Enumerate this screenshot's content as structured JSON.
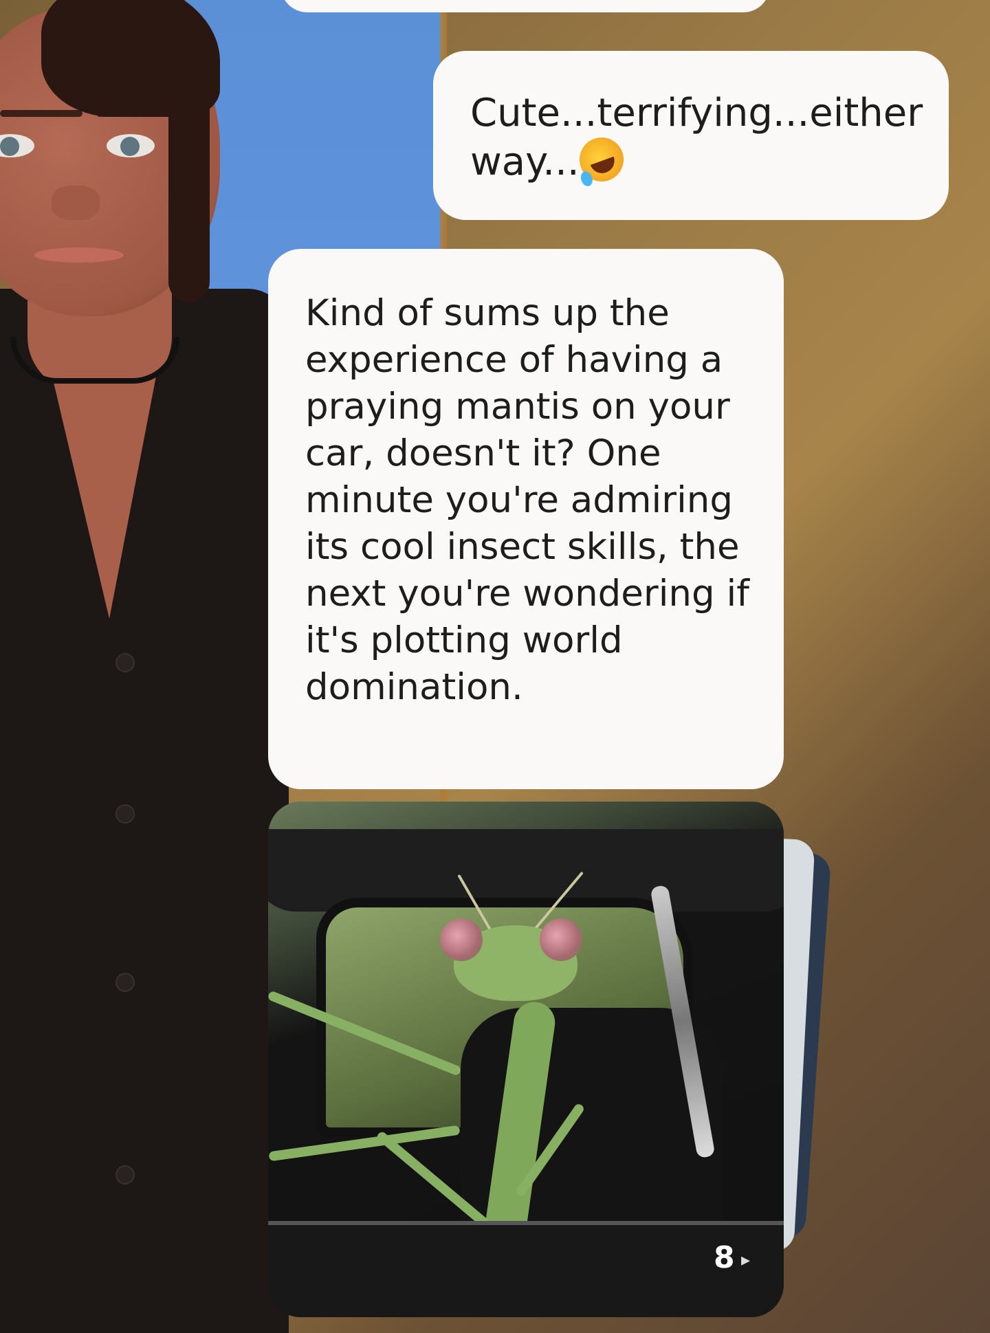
{
  "chat": {
    "messages": [
      {
        "role": "user",
        "text": "Cute...terrifying...either way..."
      },
      {
        "role": "assistant",
        "text": "Kind of sums up the experience of having a praying mantis on your car, doesn't it? One minute you're admiring its cool insect skills, the next you're wondering if it's plotting world domination."
      }
    ],
    "image_card": {
      "subject": "praying mantis in car window",
      "count_label": "8"
    },
    "user_emoji_icon": "rolling-on-floor-laughing-icon"
  },
  "colors": {
    "bubble": "#faf9f7",
    "text": "#1d1d1d",
    "background_left": "#5b8fd6",
    "background_right": "#a7844a"
  }
}
